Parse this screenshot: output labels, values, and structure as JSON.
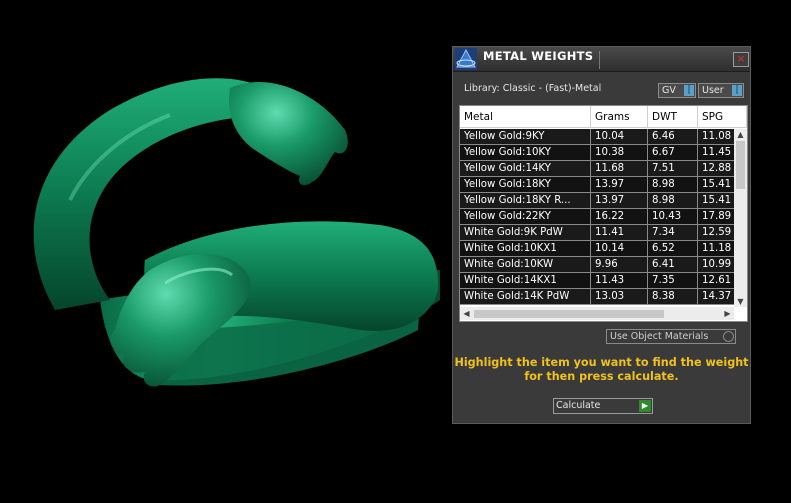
{
  "panel": {
    "title": "METAL WEIGHTS",
    "close_label": "×",
    "library_label": "Library: Classic - (Fast)-Metal",
    "gv_combo": "GV",
    "user_combo": "User",
    "columns": [
      "Metal",
      "Grams",
      "DWT",
      "SPG"
    ],
    "rows": [
      {
        "metal": "Yellow Gold:9KY",
        "grams": "10.04",
        "dwt": "6.46",
        "spg": "11.08"
      },
      {
        "metal": "Yellow Gold:10KY",
        "grams": "10.38",
        "dwt": "6.67",
        "spg": "11.45"
      },
      {
        "metal": "Yellow Gold:14KY",
        "grams": "11.68",
        "dwt": "7.51",
        "spg": "12.88"
      },
      {
        "metal": "Yellow Gold:18KY",
        "grams": "13.97",
        "dwt": "8.98",
        "spg": "15.41"
      },
      {
        "metal": "Yellow Gold:18KY R...",
        "grams": "13.97",
        "dwt": "8.98",
        "spg": "15.41"
      },
      {
        "metal": "Yellow Gold:22KY",
        "grams": "16.22",
        "dwt": "10.43",
        "spg": "17.89"
      },
      {
        "metal": "White Gold:9K PdW",
        "grams": "11.41",
        "dwt": "7.34",
        "spg": "12.59"
      },
      {
        "metal": "White Gold:10KX1",
        "grams": "10.14",
        "dwt": "6.52",
        "spg": "11.18"
      },
      {
        "metal": "White Gold:10KW",
        "grams": "9.96",
        "dwt": "6.41",
        "spg": "10.99"
      },
      {
        "metal": "White Gold:14KX1",
        "grams": "11.43",
        "dwt": "7.35",
        "spg": "12.61"
      },
      {
        "metal": "White Gold:14K PdW",
        "grams": "13.03",
        "dwt": "8.38",
        "spg": "14.37"
      }
    ],
    "use_object_materials": "Use Object Materials",
    "instructions": "Highlight the item you want to find the weight for then press calculate.",
    "calculate_label": "Calculate"
  },
  "icons": {
    "logo": "pyramid-logo-icon",
    "combo_arrow": "dropdown-arrow-icon",
    "play": "play-icon"
  },
  "colors": {
    "ring": "#0f8a5c",
    "instructions": "#f2c21b",
    "close": "#e03030",
    "combo_arrow": "#5aa0c8",
    "play": "#2f8a2f"
  }
}
